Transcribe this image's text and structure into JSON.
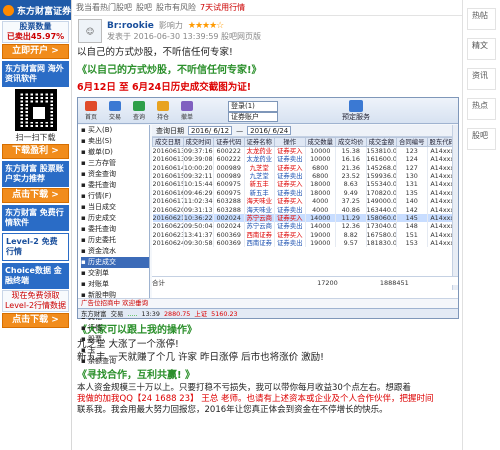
{
  "left": {
    "brand": "东方财富证券",
    "promo_line1": "股票数量",
    "promo_line2": "已卖出45.97%",
    "promo_btn": "立即开户 >",
    "banner1": "东方财富网 海外资讯软件",
    "qr_caption": "扫一扫下载",
    "btn2": "下载盈利 >",
    "banner2": "东方财富 股票账户实力推荐",
    "btn3": "点击下载 >",
    "banner3": "东方财富 免费行情软件",
    "banner4": "Level-2 免费行情",
    "banner5": "Choice数据 金融终端",
    "promo_small": "现在免费领取Level-2行情数据",
    "btn4": "点击下载 >"
  },
  "topbar": {
    "text1": "我当看热门股吧",
    "text2": "股吧",
    "text3": "股市有风险",
    "red": "7天试用行情"
  },
  "author": {
    "name": "Br:rookie",
    "level": "影响力",
    "stars": "★★★★☆",
    "meta": "发表于 2016-06-30 13:39:59 股吧网页版"
  },
  "post": {
    "line1": "以自己的方式炒股，不听信任何专家!",
    "green1": "《以自己的方式炒股，不听信任何专家!》",
    "red1": "6月12日 至 6月24日历史成交截图为证!",
    "green2": "《大家可以跟上我的操作》",
    "line2": "九芝堂     大涨了一个涨停!",
    "line3": "新五丰     一天就赚了个几  许家     昨日涨停 后市也将涨价  激励!",
    "green3": "《寻找合作，互利共赢! 》",
    "line4": "本人资金规模三十万以上。只要打稳不亏损失，我可以带你每月收益30个点左右。想跟着",
    "line5": "我做的加我QQ【24 1688 23】 王总 老师。也请有上述资本或企业及个人合作伙伴，把握时间",
    "line6": "联系我。我会用最大努力回报您，2016年让您真正体会到资金在不停增长的快乐。"
  },
  "software": {
    "toolbar": [
      "首页",
      "交易",
      "查询",
      "持仓",
      "撤单"
    ],
    "select1": "登录(1)",
    "select2": "证券账户",
    "publish": "预定服务",
    "tree": [
      "买入(B)",
      "卖出(S)",
      "撤单(D)",
      "三方存管",
      "资金查询",
      "委托查询",
      "行情(F)",
      "当日成交",
      "历史成交",
      "委托查询",
      "历史委托",
      "资金流水",
      "历史成交",
      "交割单",
      "对账单",
      "新股申购",
      "融资融券",
      "其他",
      "行情",
      "股票",
      "卡",
      "余额查询"
    ],
    "tree_selected": 12,
    "filter_label": "查询日期",
    "date_from": "2016/ 6/12",
    "date_to": "2016/ 6/24",
    "columns": [
      "成交日期",
      "成交时间",
      "证券代码",
      "证券名称",
      "操作",
      "成交数量",
      "成交均价",
      "成交金额",
      "合同编号",
      "股东代码"
    ],
    "rows": [
      [
        "20160613",
        "09:37:16",
        "600222",
        "太龙药业",
        "证券买入",
        "10000",
        "15.38",
        "153810.00",
        "123",
        "A14xxx"
      ],
      [
        "20160613",
        "09:39:08",
        "600222",
        "太龙药业",
        "证券卖出",
        "10000",
        "16.16",
        "161600.00",
        "124",
        "A14xxx"
      ],
      [
        "20160614",
        "10:00:20",
        "000989",
        "九芝堂",
        "证券买入",
        "6800",
        "21.36",
        "145268.00",
        "127",
        "A14xxx"
      ],
      [
        "20160615",
        "09:32:11",
        "000989",
        "九芝堂",
        "证券卖出",
        "6800",
        "23.52",
        "159936.00",
        "130",
        "A14xxx"
      ],
      [
        "20160615",
        "10:15:44",
        "600975",
        "新五丰",
        "证券买入",
        "18000",
        "8.63",
        "155340.00",
        "131",
        "A14xxx"
      ],
      [
        "20160616",
        "09:46:29",
        "600975",
        "新五丰",
        "证券卖出",
        "18000",
        "9.49",
        "170820.00",
        "135",
        "A14xxx"
      ],
      [
        "20160617",
        "11:02:34",
        "603288",
        "海天味业",
        "证券买入",
        "4000",
        "37.25",
        "149000.00",
        "140",
        "A14xxx"
      ],
      [
        "20160620",
        "09:31:13",
        "603288",
        "海天味业",
        "证券卖出",
        "4000",
        "40.86",
        "163440.00",
        "142",
        "A14xxx"
      ],
      [
        "20160621",
        "10:36:22",
        "002024",
        "苏宁云商",
        "证券买入",
        "14000",
        "11.29",
        "158060.00",
        "145",
        "A14xxx"
      ],
      [
        "20160622",
        "09:50:04",
        "002024",
        "苏宁云商",
        "证券卖出",
        "14000",
        "12.36",
        "173040.00",
        "148",
        "A14xxx"
      ],
      [
        "20160623",
        "13:41:37",
        "600369",
        "西南证券",
        "证券买入",
        "19000",
        "8.82",
        "167580.00",
        "151",
        "A14xxx"
      ],
      [
        "20160624",
        "09:30:58",
        "600369",
        "西南证券",
        "证券卖出",
        "19000",
        "9.57",
        "181830.00",
        "153",
        "A14xxx"
      ]
    ],
    "highlighted_row": 8,
    "sum_label": "合计",
    "sum_qty": "17200",
    "sum_amount": "1888451",
    "ribbon": "广告位招商中 欢迎垂询",
    "status_items": [
      "东方财富",
      "交易",
      ".....",
      "13:39",
      "2880.75",
      "上证",
      "5160.23"
    ]
  },
  "right": {
    "labels": [
      "热",
      "帖",
      "精",
      "文",
      "资",
      "讯",
      "热",
      "点",
      "股",
      "吧"
    ]
  }
}
